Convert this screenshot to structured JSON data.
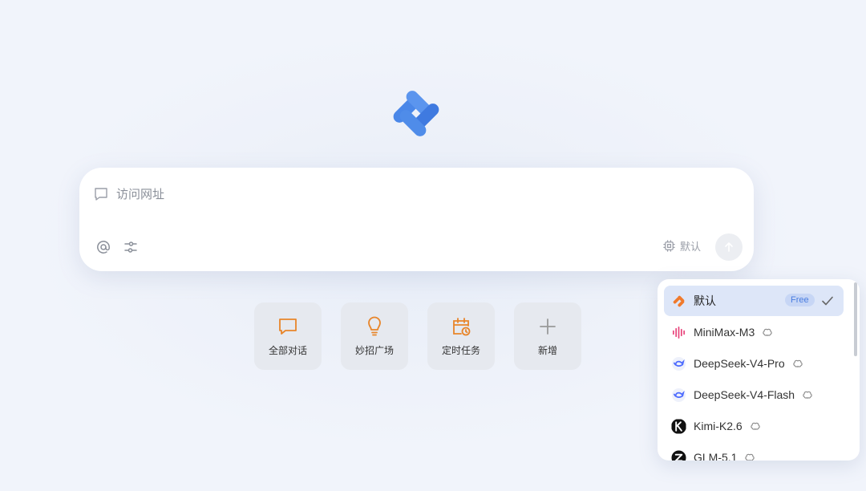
{
  "logo": {
    "icon": "app-logo-icon",
    "accent": "#4a87e8"
  },
  "input": {
    "placeholder": "访问网址",
    "icon": "chat-icon",
    "model_label": "默认",
    "tools": [
      "at-icon",
      "settings-sliders-icon"
    ],
    "send_icon": "arrow-up-icon"
  },
  "shortcuts": [
    {
      "label": "全部对话",
      "icon": "chat-bubble-icon",
      "color": "#e8852a"
    },
    {
      "label": "妙招广场",
      "icon": "lightbulb-icon",
      "color": "#e8852a"
    },
    {
      "label": "定时任务",
      "icon": "calendar-clock-icon",
      "color": "#e8852a"
    },
    {
      "label": "新增",
      "icon": "plus-icon",
      "color": "#999999"
    }
  ],
  "model_menu": {
    "items": [
      {
        "name": "默认",
        "badge": "Free",
        "selected": true,
        "icon": "default-logo-icon"
      },
      {
        "name": "MiniMax-M3",
        "icon": "minimax-icon",
        "reasoning": true
      },
      {
        "name": "DeepSeek-V4-Pro",
        "icon": "deepseek-icon",
        "reasoning": true
      },
      {
        "name": "DeepSeek-V4-Flash",
        "icon": "deepseek-icon",
        "reasoning": true
      },
      {
        "name": "Kimi-K2.6",
        "icon": "kimi-icon",
        "reasoning": true
      },
      {
        "name": "GLM-5.1",
        "icon": "glm-icon",
        "reasoning": true
      }
    ]
  }
}
